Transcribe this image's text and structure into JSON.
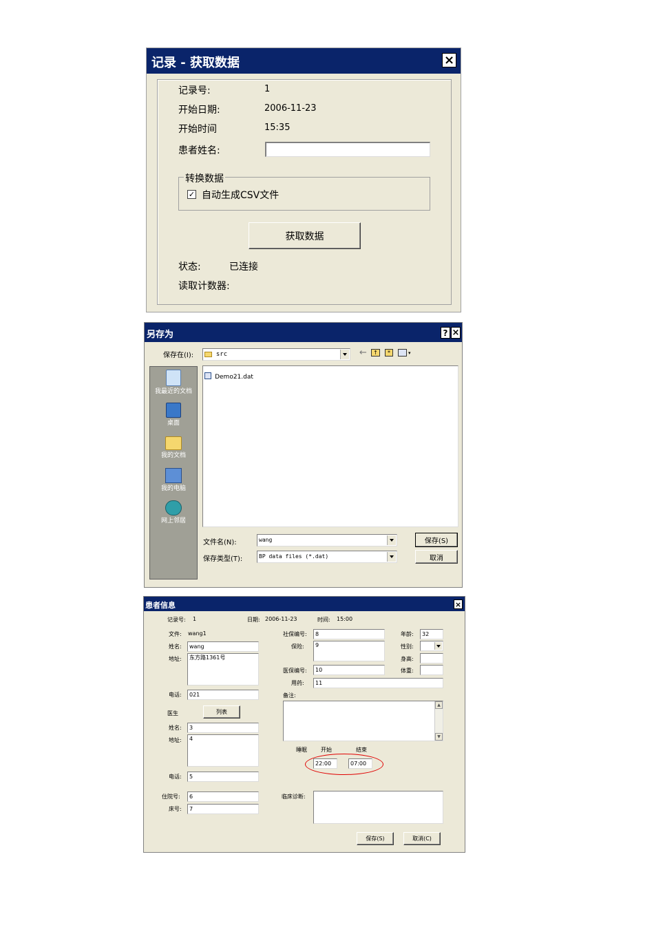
{
  "dlg1": {
    "title": "记录 - 获取数据",
    "close": "×",
    "record_label": "记录号:",
    "record_value": "1",
    "date_label": "开始日期:",
    "date_value": "2006-11-23",
    "time_label": "开始时间",
    "time_value": "15:35",
    "patient_label": "患者姓名:",
    "patient_value": "",
    "group_label": "转换数据",
    "checkbox_label": "自动生成CSV文件",
    "checkbox_checked": true,
    "fetch_button": "获取数据",
    "status_label": "状态:",
    "status_value": "已连接",
    "counter_label": "读取计数器:"
  },
  "dlg2": {
    "title": "另存为",
    "help": "?",
    "close": "×",
    "save_in_label": "保存在(I):",
    "folder_value": "src",
    "places": [
      {
        "label": "我最近的文档",
        "icon": "recent-documents-icon"
      },
      {
        "label": "桌面",
        "icon": "desktop-icon"
      },
      {
        "label": "我的文档",
        "icon": "my-documents-icon"
      },
      {
        "label": "我的电脑",
        "icon": "my-computer-icon"
      },
      {
        "label": "网上邻居",
        "icon": "network-places-icon"
      }
    ],
    "file_item": "Demo21.dat",
    "filename_label": "文件名(N):",
    "filename_value": "wang",
    "filetype_label": "保存类型(T):",
    "filetype_value": "BP data files (*.dat)",
    "save_button": "保存(S)",
    "cancel_button": "取消"
  },
  "dlg3": {
    "title": "患者信息",
    "close": "×",
    "record_label": "记录号:",
    "record_value": "1",
    "date_label": "日期:",
    "date_value": "2006-11-23",
    "time_label": "时间:",
    "time_value": "15:00",
    "file_label": "文件:",
    "file_value": "wang1",
    "name_label": "姓名:",
    "name_value": "wang",
    "address_label": "地址:",
    "address_value": "东方路1361号",
    "phone_label": "电话:",
    "phone_value": "021",
    "social_no_label": "社保编号:",
    "social_no_value": "8",
    "insurance_label": "保险:",
    "insurance_value": "9",
    "medical_no_label": "医保编号:",
    "medical_no_value": "10",
    "medication_label": "用药:",
    "medication_value": "11",
    "age_label": "年龄:",
    "age_value": "32",
    "gender_label": "性别:",
    "gender_value": "",
    "height_label": "身高:",
    "height_value": "",
    "weight_label": "体重:",
    "weight_value": "",
    "notes_label": "备注:",
    "notes_value": "",
    "doctor_label": "医生",
    "list_button": "列表",
    "doc_name_label": "姓名:",
    "doc_name_value": "3",
    "doc_address_label": "地址:",
    "doc_address_value": "4",
    "doc_phone_label": "电话:",
    "doc_phone_value": "5",
    "sleep_label": "睡眠",
    "start_label": "开始",
    "end_label": "结束",
    "sleep_start_value": "22:00",
    "sleep_end_value": "07:00",
    "admission_label": "住院号:",
    "admission_value": "6",
    "bed_label": "床号:",
    "bed_value": "7",
    "diagnosis_label": "临床诊断:",
    "diagnosis_value": "",
    "save_button": "保存(S)",
    "cancel_button": "取消(C)",
    "scroll_up": "▲",
    "scroll_down": "▼"
  },
  "colors": {
    "titlebar": "#0a246a",
    "dialog_bg": "#ece9d8",
    "places_bar": "#a0a096",
    "annotation": "#e00000"
  }
}
